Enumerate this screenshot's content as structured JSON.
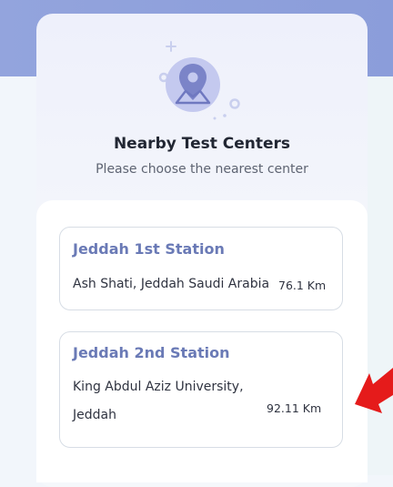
{
  "header": {
    "title": "Nearby Test Centers",
    "subtitle": "Please choose the nearest center",
    "illustration_icon": "map-pin-icon"
  },
  "centers": [
    {
      "name": "Jeddah 1st Station",
      "address": "Ash Shati, Jeddah Saudi Arabia",
      "distance": "76.1  Km"
    },
    {
      "name": "Jeddah 2nd Station",
      "address": "King Abdul Aziz University, Jeddah",
      "distance": "92.11  Km"
    }
  ],
  "colors": {
    "top_band": "#8b9dda",
    "accent_title": "#6a7ab6",
    "annotation_arrow": "#e51b1b"
  }
}
